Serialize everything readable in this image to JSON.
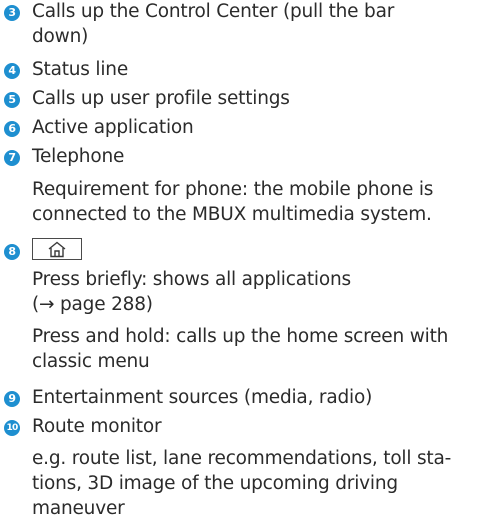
{
  "items": [
    {
      "num": "3",
      "lines": [
        "Calls up the Control Center (pull the bar",
        "down)"
      ]
    },
    {
      "num": "4",
      "lines": [
        "Status line"
      ]
    },
    {
      "num": "5",
      "lines": [
        "Calls up user profile settings"
      ]
    },
    {
      "num": "6",
      "lines": [
        "Active application"
      ]
    },
    {
      "num": "7",
      "lines": [
        "Telephone",
        "Requirement for phone: the mobile phone is",
        "connected to the MBUX multimedia system."
      ]
    },
    {
      "num": "8",
      "icon": "home-icon",
      "lines": [
        "Press briefly: shows all applications",
        "(→ page 288)",
        "Press and hold: calls up the home screen with",
        "classic menu"
      ]
    },
    {
      "num": "9",
      "lines": [
        "Entertainment sources (media, radio)"
      ]
    },
    {
      "num": "10",
      "lines": [
        "Route monitor",
        "e.g. route list, lane recommendations, toll sta-",
        "tions, 3D image of the upcoming driving",
        "maneuver"
      ]
    }
  ],
  "colors": {
    "badge": "#1e8fd0",
    "text": "#2b2b2b"
  }
}
